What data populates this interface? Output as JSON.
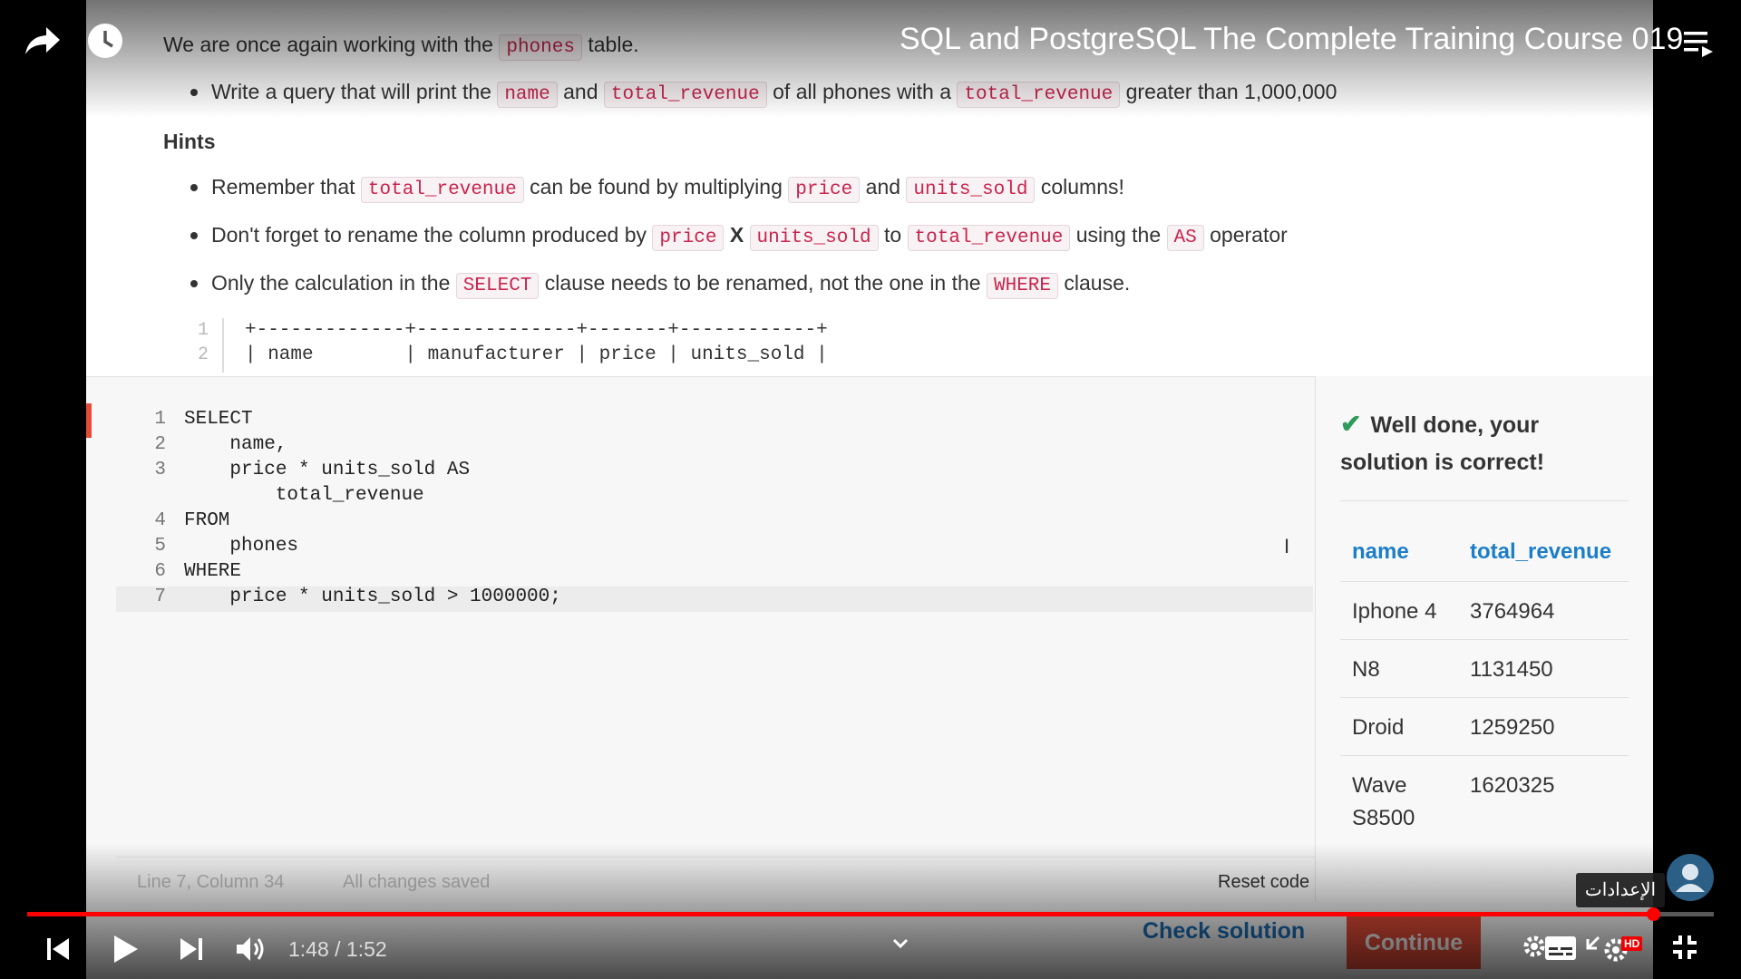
{
  "player": {
    "title": "SQL and PostgreSQL The Complete Training Course 019",
    "time": "1:48 / 1:52",
    "progress": 0.964,
    "settings_tooltip": "الإعدادات",
    "hd_badge": "HD"
  },
  "instructions": {
    "intro_pre": "We are once again working with the",
    "intro_code": "phones",
    "intro_post": "table.",
    "task_pre": "Write a query that will print the",
    "task_code1": "name",
    "task_and": "and",
    "task_code2": "total_revenue",
    "task_mid": "of all phones with a",
    "task_code3": "total_revenue",
    "task_post": "greater than 1,000,000",
    "hints_heading": "Hints",
    "hint1_pre": "Remember that",
    "hint1_code1": "total_revenue",
    "hint1_mid": "can be found by multiplying",
    "hint1_code2": "price",
    "hint1_and": "and",
    "hint1_code3": "units_sold",
    "hint1_post": "columns!",
    "hint2_pre": "Don't forget to rename the column produced by",
    "hint2_code1": "price",
    "hint2_x": "X",
    "hint2_code2": "units_sold",
    "hint2_to": "to",
    "hint2_code3": "total_revenue",
    "hint2_mid": "using the",
    "hint2_code4": "AS",
    "hint2_post": "operator",
    "hint3_pre": "Only the calculation in the",
    "hint3_code1": "SELECT",
    "hint3_mid": "clause needs to be renamed, not the one in the",
    "hint3_code2": "WHERE",
    "hint3_post": "clause."
  },
  "schema_snippet": {
    "lines": [
      {
        "num": "1",
        "text": "+-------------+--------------+-------+------------+"
      },
      {
        "num": "2",
        "text": "| name        | manufacturer | price | units_sold |"
      }
    ]
  },
  "editor": {
    "lines": [
      {
        "num": "1",
        "text": "SELECT"
      },
      {
        "num": "2",
        "text": "    name,"
      },
      {
        "num": "3",
        "text": "    price * units_sold AS"
      },
      {
        "num": "",
        "text": "        total_revenue"
      },
      {
        "num": "4",
        "text": "FROM"
      },
      {
        "num": "5",
        "text": "    phones"
      },
      {
        "num": "6",
        "text": "WHERE"
      },
      {
        "num": "7",
        "text": "    price * units_sold > 1000000;"
      }
    ],
    "status_position": "Line 7, Column 34",
    "status_saved": "All changes saved",
    "reset_label": "Reset code"
  },
  "results": {
    "message": "Well done, your solution is correct!",
    "columns": [
      "name",
      "total_revenue"
    ],
    "rows": [
      [
        "Iphone 4",
        "3764964"
      ],
      [
        "N8",
        "1131450"
      ],
      [
        "Droid",
        "1259250"
      ],
      [
        "Wave S8500",
        "1620325"
      ]
    ]
  },
  "footer": {
    "check_label": "Check solution",
    "continue_label": "Continue"
  },
  "colors": {
    "accent_red": "#e44c38",
    "link_blue": "#1c7ec8",
    "success_green": "#2e9b5b",
    "youtube_red": "#ff0000"
  }
}
